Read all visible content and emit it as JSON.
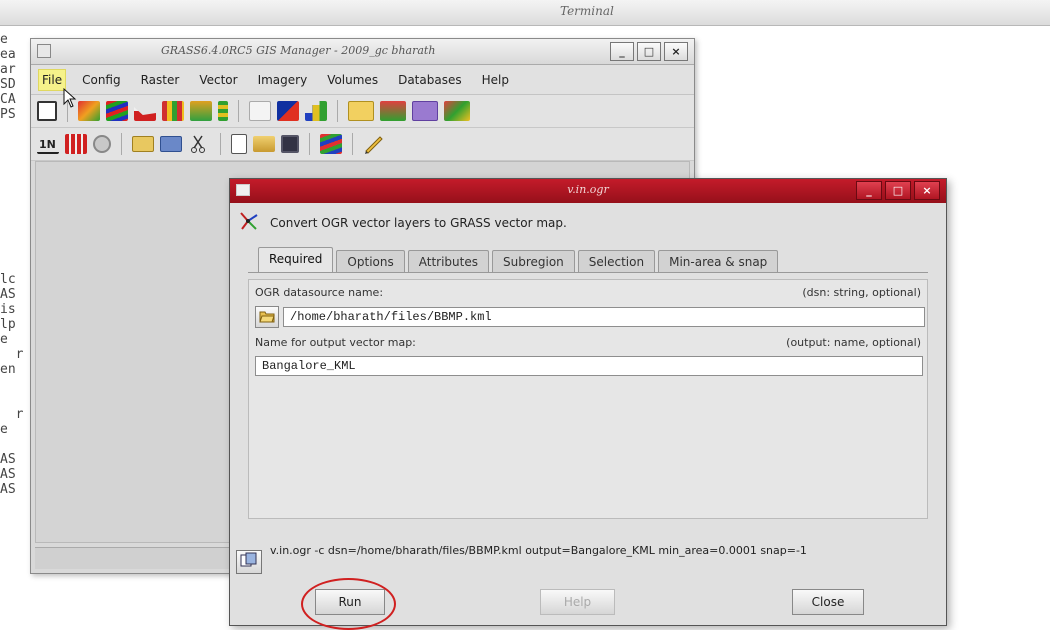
{
  "terminal": {
    "title": "Terminal",
    "lines": [
      "e  ",
      "ea",
      "ar",
      "SD",
      "CA",
      "PS",
      "",
      "",
      "",
      "",
      "",
      "",
      "",
      "",
      "",
      "",
      "lc",
      "AS",
      "is",
      "lp",
      "e",
      "  r",
      "en",
      "",
      "",
      "  r",
      "e",
      "",
      "AS",
      "AS",
      "AS"
    ]
  },
  "gis_manager": {
    "title": "GRASS6.4.0RC5 GIS Manager - 2009_gc bharath",
    "menu": [
      "File",
      "Config",
      "Raster",
      "Vector",
      "Imagery",
      "Volumes",
      "Databases",
      "Help"
    ],
    "window_buttons": [
      "_",
      "□",
      "×"
    ]
  },
  "dialog": {
    "title": "v.in.ogr",
    "description": "Convert OGR vector layers to GRASS vector map.",
    "window_buttons": [
      "_",
      "□",
      "×"
    ],
    "tabs": [
      "Required",
      "Options",
      "Attributes",
      "Subregion",
      "Selection",
      "Min-area & snap"
    ],
    "active_tab": "Required",
    "dsn_label": "OGR datasource name:",
    "dsn_hint": "(dsn: string, optional)",
    "dsn_value": "/home/bharath/files/BBMP.kml",
    "output_label": "Name for output vector map:",
    "output_hint": "(output: name, optional)",
    "output_value": "Bangalore_KML",
    "command": "v.in.ogr -c dsn=/home/bharath/files/BBMP.kml output=Bangalore_KML min_area=0.0001 snap=-1",
    "buttons": {
      "run": "Run",
      "help": "Help",
      "close": "Close"
    }
  },
  "colors": {
    "dialog_titlebar": "#b01522",
    "highlight_menu": "#f6f28a",
    "annotation": "#d02020"
  }
}
